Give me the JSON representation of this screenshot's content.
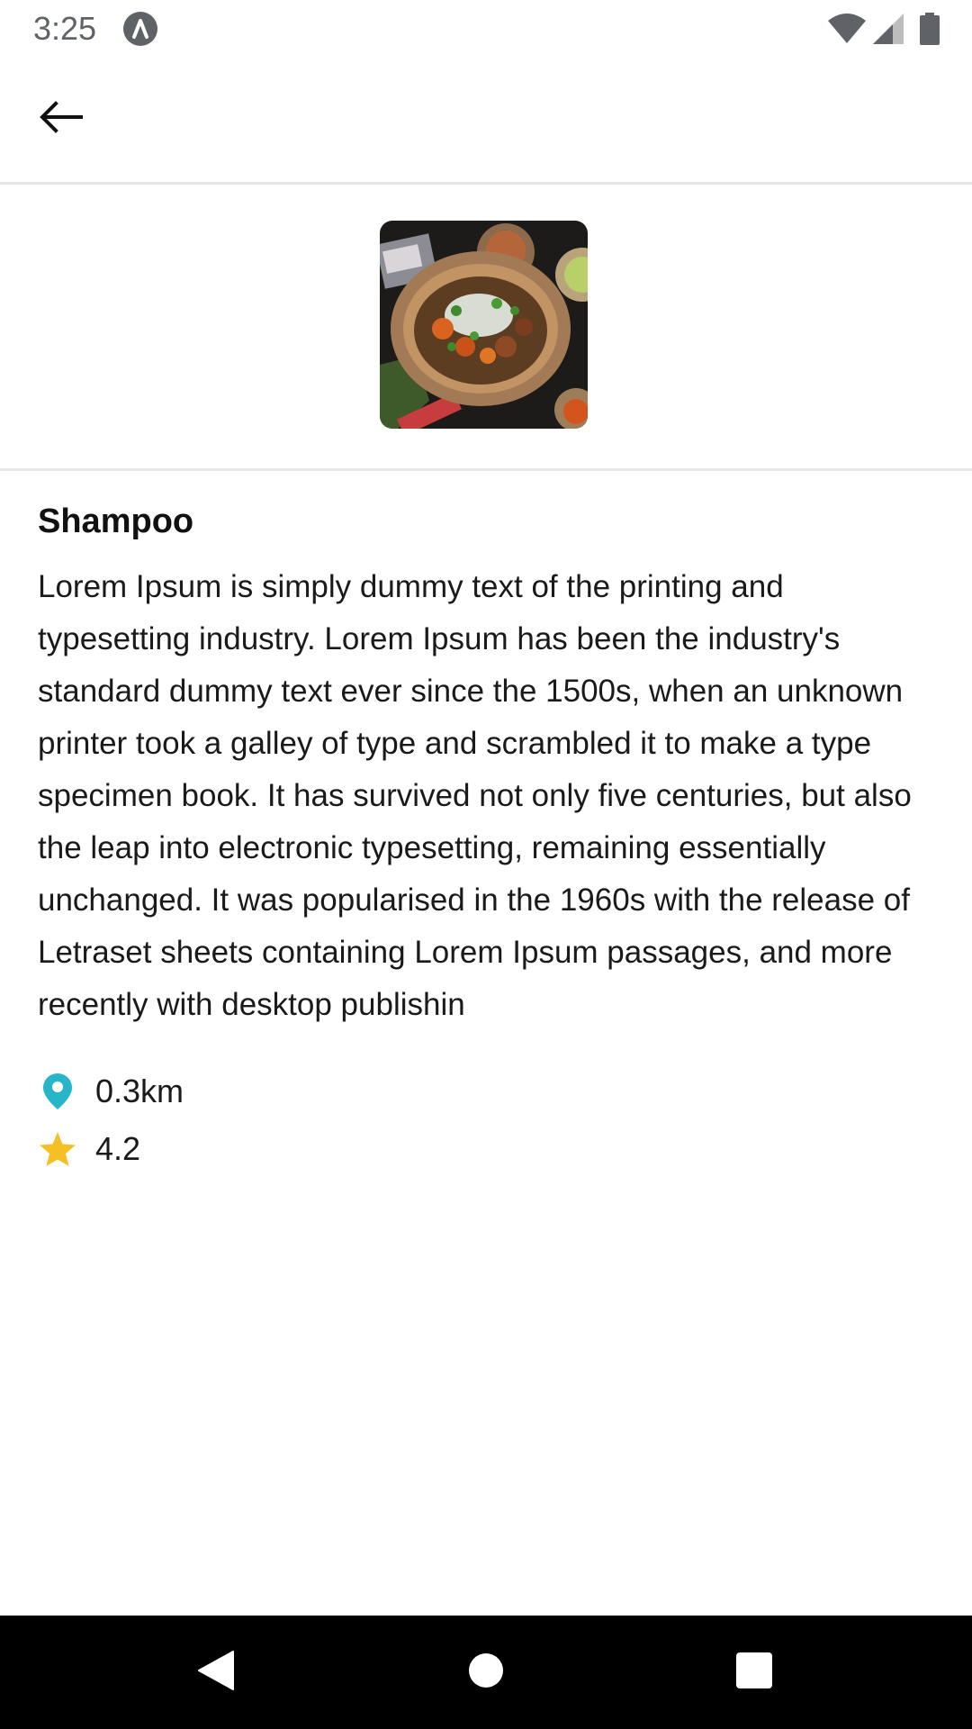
{
  "status_bar": {
    "time": "3:25",
    "app_icon": "android-studio-icon",
    "wifi_icon": "wifi-icon",
    "signal_icon": "cell-signal-icon",
    "battery_icon": "battery-icon"
  },
  "app_bar": {
    "back_icon": "arrow-back-icon"
  },
  "product": {
    "image_description": "bowl-of-food-photo",
    "title": "Shampoo",
    "description": "Lorem Ipsum is simply dummy text of the printing and typesetting industry. Lorem Ipsum has been the industry's standard dummy text ever since the 1500s, when an unknown printer took a galley of type and scrambled it to make a type specimen book. It has survived not only five centuries, but also the leap into electronic typesetting, remaining essentially unchanged. It was popularised in the 1960s with the release of Letraset sheets containing Lorem Ipsum passages, and more recently with desktop publishin",
    "distance": "0.3km",
    "rating": "4.2"
  },
  "colors": {
    "location_pin": "#26b5c9",
    "star": "#f5c026",
    "divider": "#e6e6e6",
    "nav_bar": "#000000"
  },
  "nav_bar": {
    "back": "nav-back-icon",
    "home": "nav-home-icon",
    "recents": "nav-recents-icon"
  }
}
